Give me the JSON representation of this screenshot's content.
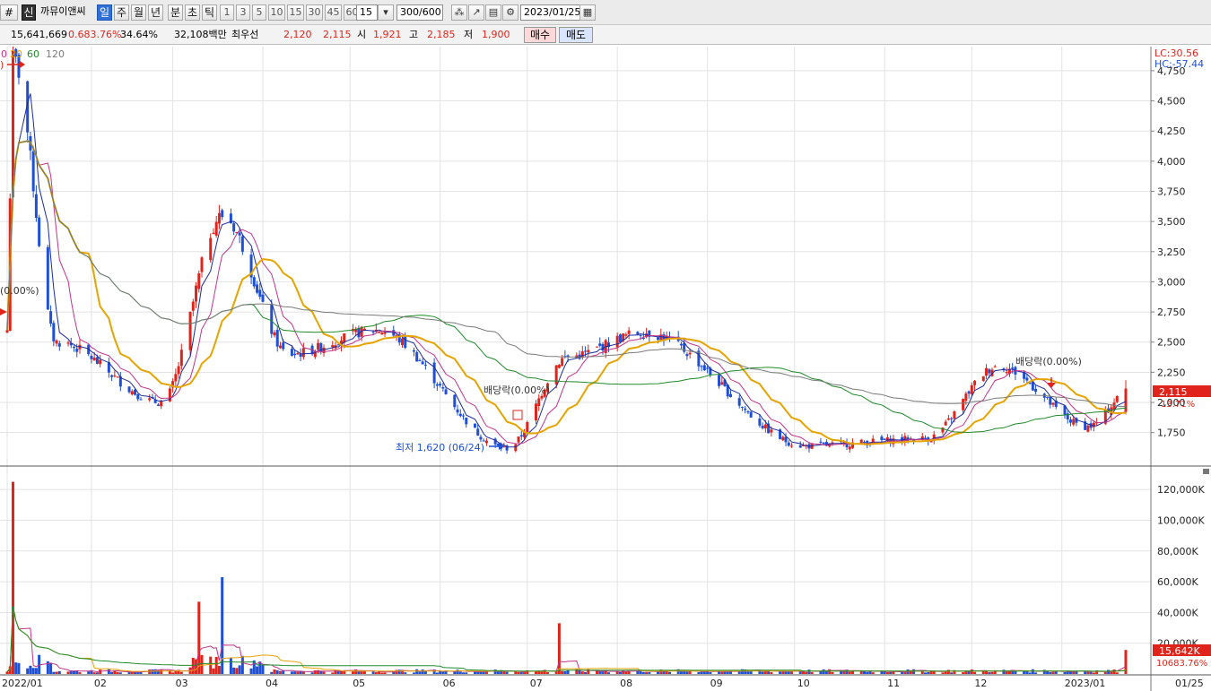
{
  "toolbar": {
    "code_fragment": "#",
    "market_badge": "신",
    "stock_name": "까뮤이앤씨",
    "period_buttons": [
      "일",
      "주",
      "월",
      "년",
      "분",
      "초",
      "틱"
    ],
    "active_period": "일",
    "interval_buttons": [
      "1",
      "3",
      "5",
      "10",
      "15",
      "30",
      "45",
      "60"
    ],
    "interval_value": "15",
    "count_value": "300/600",
    "date_value": "2023/01/25"
  },
  "info_bar": {
    "volume": "15,641,669",
    "volume_ratio": "0.683.76%",
    "turnover": "34.64%",
    "amount": "32,108백만",
    "best_bid_label": "최우선",
    "best_ask": "2,120",
    "best_bid": "2,115",
    "open_label": "시",
    "open": "1,921",
    "high_label": "고",
    "high": "2,185",
    "low_label": "저",
    "low": "1,900",
    "buy_button": "매수",
    "sell_button": "매도"
  },
  "legend": {
    "ma_labels": [
      "0",
      "20",
      "60",
      "120"
    ],
    "ma_colors": [
      "#c2338a",
      "#e6a400",
      "#1e8a2a",
      "#7a7a7a"
    ]
  },
  "top_right": {
    "lc": "LC:30.56",
    "hc": "HC:-57.44"
  },
  "annotations": {
    "left_marker": ")",
    "left_dividend": "(0.00%)",
    "mid_dividend": "배당락(0.00%)",
    "right_dividend": "배당락(0.00%)",
    "low_marker": "최저 1,620 (06/24)"
  },
  "current": {
    "price": "2,115",
    "change": "13.71%",
    "volume_label": "15,642K",
    "volume_pct": "10683.76%"
  },
  "colors": {
    "up": "#e0241b",
    "down": "#1f4fd4",
    "ma5": "#1c2a9e",
    "ma10": "#c2338a",
    "ma20": "#e6a400",
    "ma60": "#1e8a2a",
    "ma120": "#7a7a7a"
  },
  "chart_data": {
    "type": "candlestick",
    "title": "",
    "price_axis": {
      "ticks": [
        1750,
        2000,
        2250,
        2500,
        2750,
        3000,
        3250,
        3500,
        3750,
        4000,
        4250,
        4500,
        4750
      ],
      "tick_labels": [
        "1,750",
        "2,000",
        "2,250",
        "2,500",
        "2,750",
        "3,000",
        "3,250",
        "3,500",
        "3,750",
        "4,000",
        "4,250",
        "4,500",
        "4,750"
      ],
      "ylim": [
        1480,
        4950
      ]
    },
    "volume_axis": {
      "ticks": [
        20000,
        40000,
        60000,
        80000,
        100000,
        120000
      ],
      "tick_labels": [
        "20,000K",
        "40,000K",
        "60,000K",
        "80,000K",
        "100,000K",
        "120,000K"
      ],
      "ylim": [
        0,
        130000
      ]
    },
    "x_axis": {
      "tick_labels": [
        "2022/01",
        "02",
        "03",
        "04",
        "05",
        "06",
        "07",
        "08",
        "09",
        "10",
        "11",
        "12",
        "2023/01",
        "01/25"
      ]
    },
    "key_points": [
      {
        "x": "2022-01-03",
        "price": 2600
      },
      {
        "x": "2022-01-05",
        "price": 4850
      },
      {
        "x": "2022-01-20",
        "price": 2500
      },
      {
        "x": "2022-02-25",
        "price": 2000
      },
      {
        "x": "2022-03-18",
        "price": 3550
      },
      {
        "x": "2022-04-10",
        "price": 2400
      },
      {
        "x": "2022-05-10",
        "price": 2600
      },
      {
        "x": "2022-06-24",
        "price": 1620
      },
      {
        "x": "2022-07-15",
        "price": 2380
      },
      {
        "x": "2022-08-10",
        "price": 2580
      },
      {
        "x": "2022-10-05",
        "price": 1640
      },
      {
        "x": "2022-11-15",
        "price": 1700
      },
      {
        "x": "2022-12-10",
        "price": 2300
      },
      {
        "x": "2023-01-10",
        "price": 1800
      },
      {
        "x": "2023-01-25",
        "price": 2115
      }
    ],
    "volume_spikes": [
      {
        "x": "2022-01-05",
        "volume": 125000
      },
      {
        "x": "2022-03-18",
        "volume": 63000
      },
      {
        "x": "2022-03-10",
        "volume": 47000
      },
      {
        "x": "2022-07-12",
        "volume": 33000
      },
      {
        "x": "2023-01-25",
        "volume": 15642
      }
    ],
    "grid": true
  }
}
